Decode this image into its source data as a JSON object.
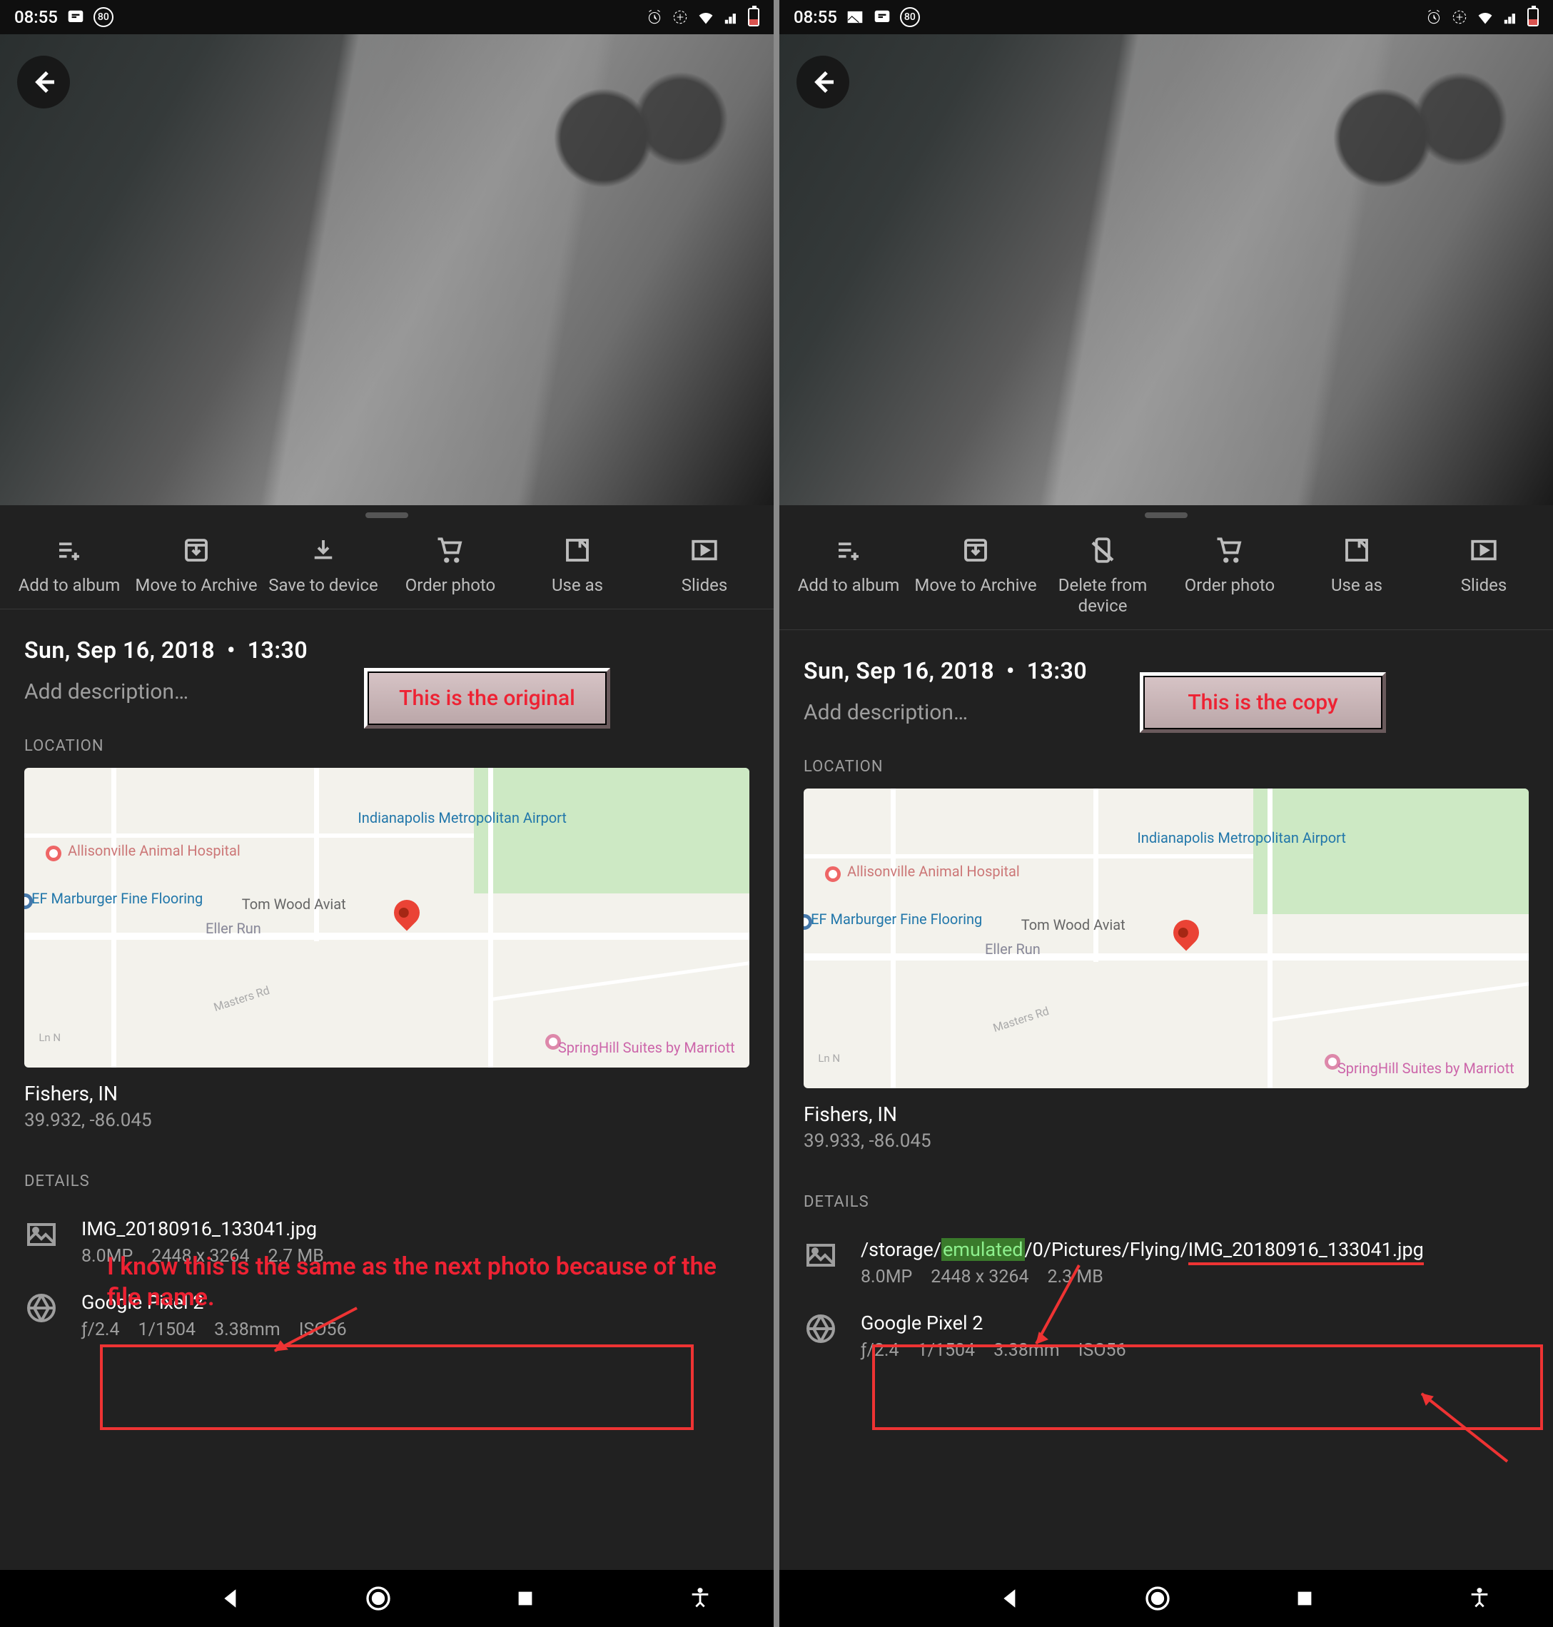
{
  "status": {
    "time": "08:55",
    "battery_badge": "80"
  },
  "left": {
    "actions": [
      {
        "key": "add",
        "label": "Add to album"
      },
      {
        "key": "archive",
        "label": "Move to Archive"
      },
      {
        "key": "save",
        "label": "Save to device"
      },
      {
        "key": "order",
        "label": "Order photo"
      },
      {
        "key": "useas",
        "label": "Use as"
      },
      {
        "key": "slides",
        "label": "Slides"
      }
    ],
    "date": "Sun, Sep 16, 2018",
    "time": "13:30",
    "desc_placeholder": "Add description…",
    "location_header": "LOCATION",
    "map": {
      "airport": "Indianapolis Metropolitan Airport",
      "hospital": "Allisonville Animal Hospital",
      "flooring": "EF Marburger Fine Flooring",
      "aviation": "Tom Wood Aviat",
      "eller": "Eller Run",
      "masters": "Masters Rd",
      "spring": "SpringHill Suites by Marriott",
      "ln": "Ln N"
    },
    "loc_name": "Fishers, IN",
    "loc_coords": "39.932, -86.045",
    "details_header": "DETAILS",
    "file": {
      "name": "IMG_20180916_133041.jpg",
      "mp": "8.0MP",
      "dims": "2448 x 3264",
      "size": "2.7 MB"
    },
    "camera": {
      "name": "Google Pixel 2",
      "aperture": "ƒ/2.4",
      "shutter": "1/1504",
      "focal": "3.38mm",
      "iso": "ISO56"
    },
    "annotation_label": "This is the original",
    "annotation_text": "I know this is the same as the next photo because of the file name."
  },
  "right": {
    "actions": [
      {
        "key": "add",
        "label": "Add to album"
      },
      {
        "key": "archive",
        "label": "Move to Archive"
      },
      {
        "key": "delete",
        "label": "Delete from device"
      },
      {
        "key": "order",
        "label": "Order photo"
      },
      {
        "key": "useas",
        "label": "Use as"
      },
      {
        "key": "slides",
        "label": "Slides"
      }
    ],
    "date": "Sun, Sep 16, 2018",
    "time": "13:30",
    "desc_placeholder": "Add description…",
    "location_header": "LOCATION",
    "map": {
      "airport": "Indianapolis Metropolitan Airport",
      "hospital": "Allisonville Animal Hospital",
      "flooring": "EF Marburger Fine Flooring",
      "aviation": "Tom Wood Aviat",
      "eller": "Eller Run",
      "masters": "Masters Rd",
      "spring": "SpringHill Suites by Marriott",
      "ln": "Ln N"
    },
    "loc_name": "Fishers, IN",
    "loc_coords": "39.933, -86.045",
    "details_header": "DETAILS",
    "file": {
      "path_pre": "/storage/",
      "path_hl": "emulated",
      "path_mid": "/0/Pictures/Flying/",
      "path_end": "IMG_20180916_133041.jpg",
      "mp": "8.0MP",
      "dims": "2448 x 3264",
      "size": "2.3 MB"
    },
    "camera": {
      "name": "Google Pixel 2",
      "aperture": "ƒ/2.4",
      "shutter": "1/1504",
      "focal": "3.38mm",
      "iso": "ISO56"
    },
    "annotation_label": "This is the copy"
  }
}
